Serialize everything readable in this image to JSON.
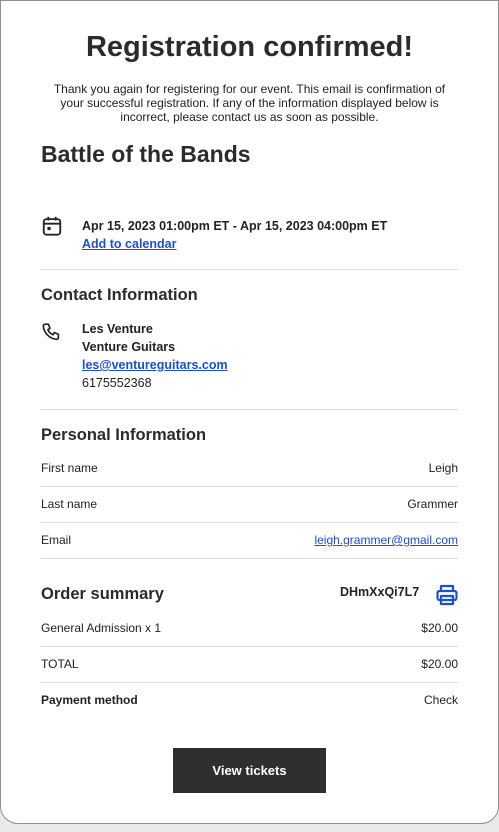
{
  "header": {
    "title": "Registration confirmed!",
    "intro": "Thank you again for registering for our event. This email is confirmation of your successful registration. If any of the information displayed below is incorrect, please contact us as soon as possible."
  },
  "event": {
    "name": "Battle of the Bands",
    "datetime": "Apr 15, 2023 01:00pm ET - Apr 15, 2023 04:00pm ET",
    "add_to_calendar": "Add to calendar",
    "icon": "calendar-icon"
  },
  "contact": {
    "title": "Contact Information",
    "icon": "phone-icon",
    "name": "Les Venture",
    "company": "Venture Guitars",
    "email": "les@ventureguitars.com",
    "phone": "6175552368"
  },
  "personal": {
    "title": "Personal Information",
    "fields": [
      {
        "label": "First name",
        "value": "Leigh"
      },
      {
        "label": "Last name",
        "value": "Grammer"
      },
      {
        "label": "Email",
        "value": "leigh.grammer@gmail.com"
      }
    ]
  },
  "order": {
    "title": "Order summary",
    "code": "DHmXxQi7L7",
    "print_icon": "printer-icon",
    "items": [
      {
        "label": "General Admission x 1",
        "value": "$20.00"
      },
      {
        "label": "TOTAL",
        "value": "$20.00"
      },
      {
        "label": "Payment method",
        "value": "Check"
      }
    ]
  },
  "actions": {
    "view_tickets": "View tickets"
  },
  "colors": {
    "link": "#1a4fd6",
    "button_bg": "#2f2f2f",
    "divider": "#dcdcdc"
  }
}
